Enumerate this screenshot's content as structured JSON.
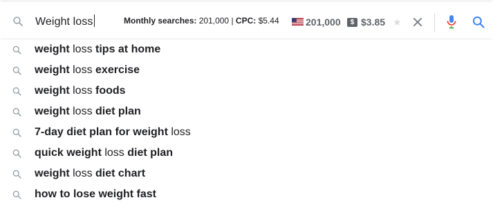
{
  "search": {
    "query": "Weight loss",
    "metrics_label": "Monthly searches:",
    "metrics_value": "201,000",
    "metrics_sep": "|",
    "cpc_label": "CPC:",
    "cpc_value": "$5.44",
    "volume": "201,000",
    "dollar_badge": "$",
    "cpc_badge_value": "$3.85",
    "star_glyph": "★"
  },
  "icons": {
    "query_icon": "search-icon",
    "flag": "us-flag-icon",
    "clear": "close-icon",
    "mic": "microphone-icon",
    "submit": "search-icon"
  },
  "colors": {
    "mic_blue": "#4285f4",
    "mic_red": "#ea4335",
    "mic_yellow": "#fbbc04",
    "mic_green": "#34a853",
    "search_blue": "#4285f4"
  },
  "suggestions": [
    [
      [
        "weight",
        "b"
      ],
      [
        " loss ",
        "n"
      ],
      [
        "tips at home",
        "b"
      ]
    ],
    [
      [
        "weight",
        "b"
      ],
      [
        " loss ",
        "n"
      ],
      [
        "exercise",
        "b"
      ]
    ],
    [
      [
        "weight",
        "b"
      ],
      [
        " loss ",
        "n"
      ],
      [
        "foods",
        "b"
      ]
    ],
    [
      [
        "weight",
        "b"
      ],
      [
        " loss ",
        "n"
      ],
      [
        "diet plan",
        "b"
      ]
    ],
    [
      [
        "7-day diet plan for weight",
        "b"
      ],
      [
        " loss",
        "n"
      ]
    ],
    [
      [
        "quick weight",
        "b"
      ],
      [
        " loss ",
        "n"
      ],
      [
        "diet plan",
        "b"
      ]
    ],
    [
      [
        "weight",
        "b"
      ],
      [
        " loss ",
        "n"
      ],
      [
        "diet chart",
        "b"
      ]
    ],
    [
      [
        "how to lose weight fast",
        "b"
      ]
    ]
  ]
}
